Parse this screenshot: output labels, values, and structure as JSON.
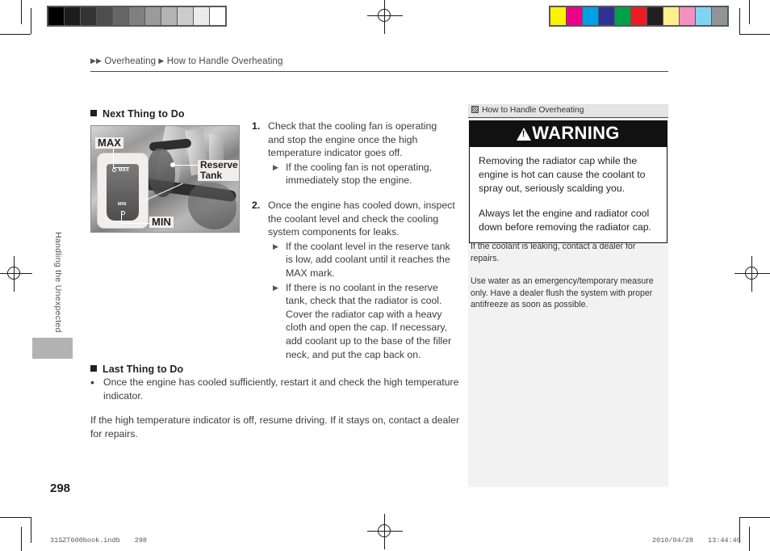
{
  "print_marks": {
    "grayscale_wedge": [
      "#000000",
      "#1c1c1c",
      "#333333",
      "#4d4d4d",
      "#666666",
      "#808080",
      "#9a9a9a",
      "#b3b3b3",
      "#cccccc",
      "#ebebeb",
      "#ffffff"
    ],
    "color_patches": [
      "#fff200",
      "#ec008c",
      "#00a0e4",
      "#2e3192",
      "#00a14b",
      "#ed1c24",
      "#231f20",
      "#fdf08a",
      "#f390c0",
      "#7fd4f5",
      "#929497"
    ]
  },
  "breadcrumb": {
    "arrow": "▶",
    "level1": "Overheating",
    "level2": "How to Handle Overheating"
  },
  "side_tab": {
    "label": "Handling the Unexpected"
  },
  "main": {
    "next_thing": {
      "heading": "Next Thing to Do",
      "steps": [
        {
          "num": "1.",
          "text": "Check that the cooling fan is operating and stop the engine once the high temperature indicator goes off.",
          "subs": [
            "If the cooling fan is not operating, immediately stop the engine."
          ]
        },
        {
          "num": "2.",
          "text": "Once the engine has cooled down, inspect the coolant level and check the cooling system components for leaks.",
          "subs": [
            "If the coolant level in the reserve tank is low, add coolant until it reaches the MAX mark.",
            "If there is no coolant in the reserve tank, check that the radiator is cool. Cover the radiator cap with a heavy cloth and open the cap. If necessary, add coolant up to the base of the filler neck, and put the cap back on."
          ]
        }
      ]
    },
    "last_thing": {
      "heading": "Last Thing to Do",
      "bullet": "Once the engine has cooled sufficiently, restart it and check the high temperature indicator.",
      "paragraph": "If the high temperature indicator is off, resume driving. If it stays on, contact a dealer for repairs."
    },
    "photo": {
      "callout_max": "MAX",
      "callout_min": "MIN",
      "callout_reserve_tank": "Reserve\nTank",
      "callout_reserve_tank_line1": "Reserve",
      "callout_reserve_tank_line2": "Tank",
      "inset_max_label": "MAX",
      "inset_min_label": "MIN"
    }
  },
  "sidebar": {
    "header": "How to Handle Overheating",
    "warning": {
      "title": "WARNING",
      "paragraph1": "Removing the radiator cap while the engine is hot can cause the coolant to spray out, seriously scalding you.",
      "paragraph2": "Always let the engine and radiator cool down before removing the radiator cap."
    },
    "notes": [
      "If the coolant is leaking, contact a dealer for repairs.",
      "Use water as an emergency/temporary measure only. Have a dealer flush the system with proper antifreeze as soon as possible."
    ]
  },
  "page_number": "298",
  "footer": {
    "file": "31SZT600book.indb",
    "page": "298",
    "date": "2010/04/28",
    "time": "13:44:40"
  }
}
